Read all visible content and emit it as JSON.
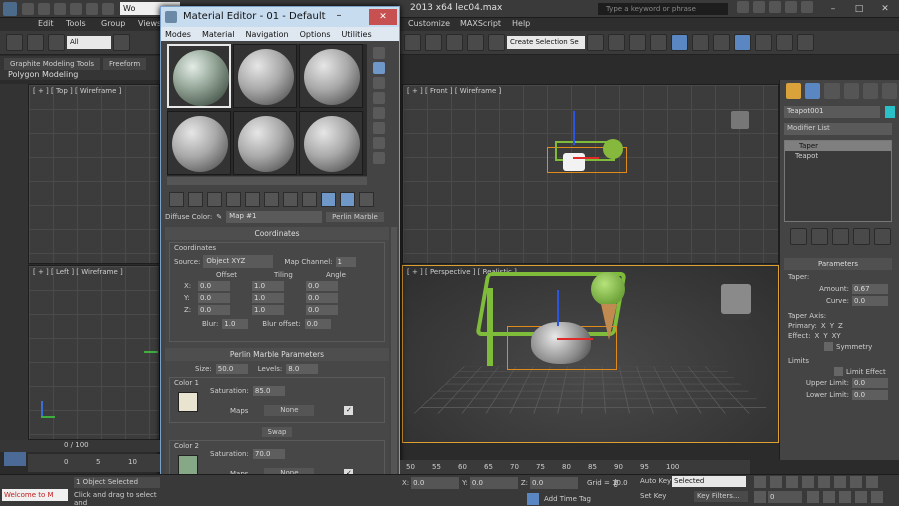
{
  "app": {
    "workspace": "Wo",
    "title": "2013 x64     lec04.max",
    "search_placeholder": "Type a keyword or phrase",
    "menus": [
      "Edit",
      "Tools",
      "Group",
      "Views",
      "Customize",
      "MAXScript",
      "Help"
    ]
  },
  "main_toolbar": {
    "selection_filter": "All",
    "named_selection": "Create Selection Se"
  },
  "ribbon": {
    "tabs": [
      "Graphite Modeling Tools",
      "Freeform"
    ],
    "panel_label": "Polygon Modeling"
  },
  "viewports": {
    "top": "[ + ] [ Top ] [ Wireframe ]",
    "front": "[ + ] [ Front ] [ Wireframe ]",
    "left": "[ + ] [ Left ] [ Wireframe ]",
    "perspective": "[ + ] [ Perspective ] [ Realistic ]"
  },
  "material_editor": {
    "title": "Material Editor - 01 - Default",
    "menus": [
      "Modes",
      "Material",
      "Navigation",
      "Options",
      "Utilities"
    ],
    "diffuse_label": "Diffuse Color:",
    "map_name": "Map #1",
    "map_type": "Perlin Marble",
    "coordinates": {
      "header": "Coordinates",
      "group_label": "Coordinates",
      "source_label": "Source:",
      "source_value": "Object XYZ",
      "map_channel_label": "Map Channel:",
      "map_channel_value": "1",
      "col_offset": "Offset",
      "col_tiling": "Tiling",
      "col_angle": "Angle",
      "axes": [
        "X:",
        "Y:",
        "Z:"
      ],
      "offset": [
        "0.0",
        "0.0",
        "0.0"
      ],
      "tiling": [
        "1.0",
        "1.0",
        "1.0"
      ],
      "angle": [
        "0.0",
        "0.0",
        "0.0"
      ],
      "blur_label": "Blur:",
      "blur_value": "1.0",
      "blur_offset_label": "Blur offset:",
      "blur_offset_value": "0.0"
    },
    "perlin": {
      "header": "Perlin Marble Parameters",
      "size_label": "Size:",
      "size_value": "50.0",
      "levels_label": "Levels:",
      "levels_value": "8.0",
      "color1_label": "Color 1",
      "color1_hex": "#e8e4cf",
      "saturation_label": "Saturation:",
      "saturation1_value": "85.0",
      "maps_label": "Maps",
      "none_label": "None",
      "swap_label": "Swap",
      "color2_label": "Color 2",
      "color2_hex": "#86a886",
      "saturation2_value": "70.0"
    }
  },
  "command_panel": {
    "object_name": "Teapot001",
    "modifier_list": "Modifier List",
    "stack": [
      "Taper",
      "Teapot"
    ],
    "parameters_header": "Parameters",
    "taper_label": "Taper:",
    "amount_label": "Amount:",
    "amount_value": "0.67",
    "curve_label": "Curve:",
    "curve_value": "0.0",
    "taper_axis_label": "Taper Axis:",
    "primary_label": "Primary:",
    "effect_label": "Effect:",
    "axis_opts": [
      "X",
      "Y",
      "Z"
    ],
    "effect_opts": [
      "X",
      "Y",
      "XY"
    ],
    "symmetry_label": "Symmetry",
    "limits_label": "Limits",
    "limit_effect_label": "Limit Effect",
    "upper_label": "Upper Limit:",
    "upper_value": "0.0",
    "lower_label": "Lower Limit:",
    "lower_value": "0.0"
  },
  "timeline": {
    "frame": "0 / 100",
    "ticks": [
      "0",
      "5",
      "10",
      "50",
      "55",
      "60",
      "65",
      "70",
      "75",
      "80",
      "85",
      "90",
      "95",
      "100"
    ]
  },
  "status": {
    "script_listener": "Welcome to M",
    "selected": "1 Object Selected",
    "prompt": "Click and drag to select and",
    "x": "0.0",
    "y": "0.0",
    "z": "0.0",
    "grid": "Grid = 10.0",
    "add_time_tag": "Add Time Tag",
    "auto_key": "Auto Key",
    "set_key": "Set Key",
    "key_mode": "Selected",
    "key_filters": "Key Filters...",
    "current_frame": "0"
  }
}
